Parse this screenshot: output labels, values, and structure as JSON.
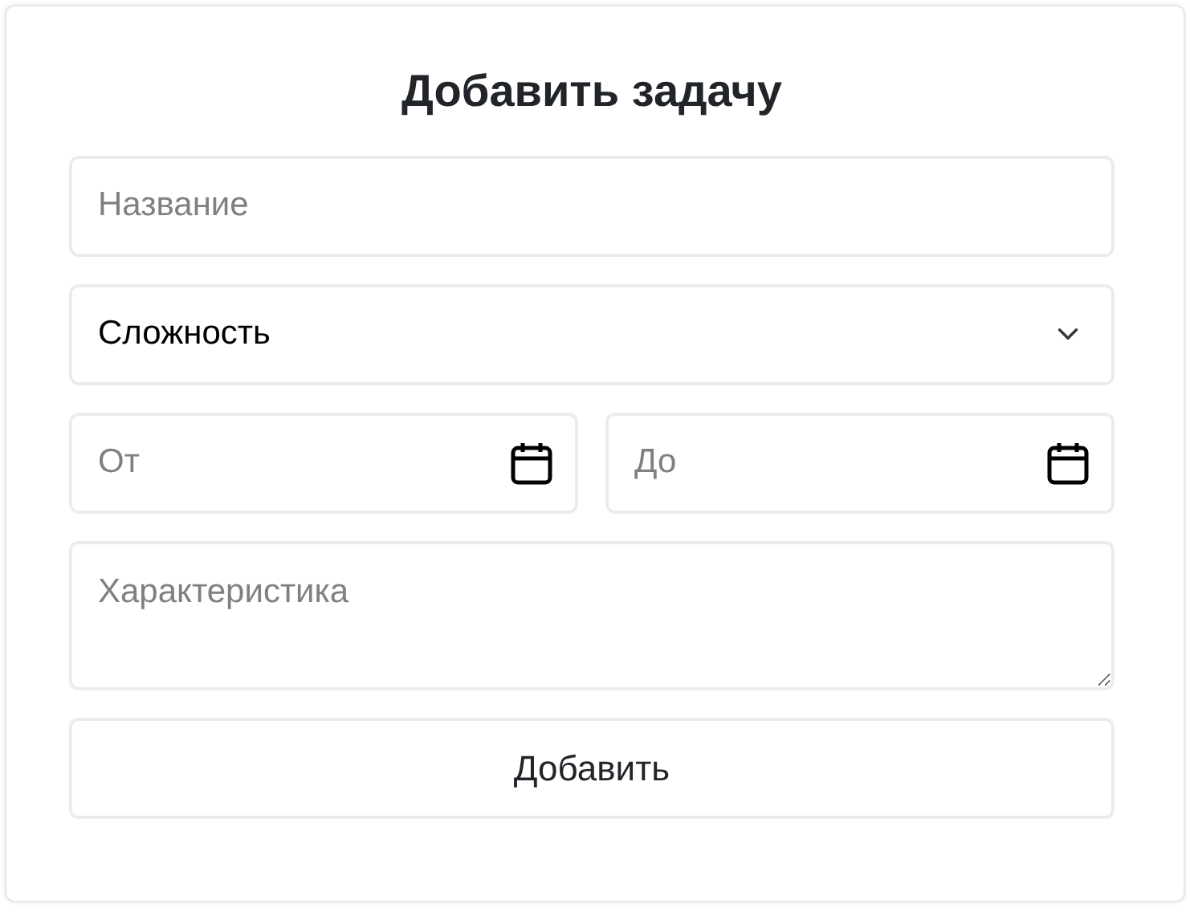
{
  "title": "Добавить задачу",
  "fields": [
    {
      "kind": "text",
      "placeholder": "Название"
    },
    {
      "kind": "select",
      "value": "Сложность"
    },
    {
      "kind": "dates",
      "items": [
        {
          "placeholder": "От"
        },
        {
          "placeholder": "До"
        }
      ]
    },
    {
      "kind": "textarea",
      "placeholder": "Характеристика"
    }
  ],
  "button": "Добавить"
}
